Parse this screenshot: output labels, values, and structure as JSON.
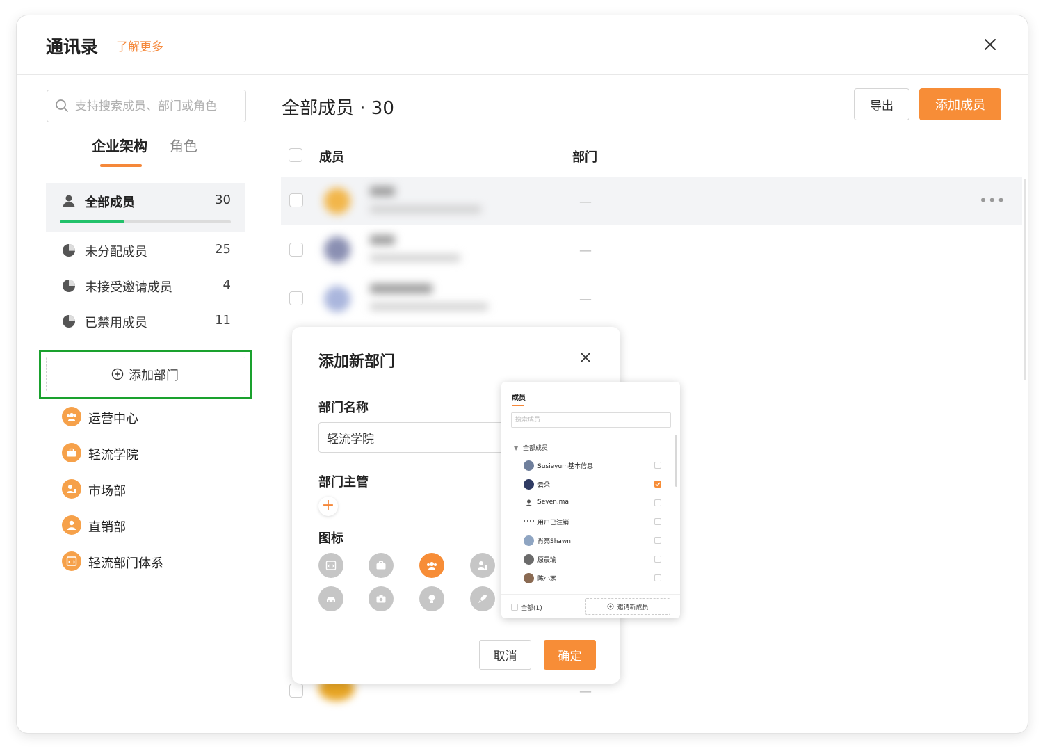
{
  "window": {
    "title": "通讯录",
    "learn_more": "了解更多"
  },
  "sidebar": {
    "search_placeholder": "支持搜索成员、部门或角色",
    "tabs": [
      {
        "label": "企业架构",
        "active": true
      },
      {
        "label": "角色",
        "active": false
      }
    ],
    "all_members": {
      "label": "全部成员",
      "count": "30",
      "progress": 0.38
    },
    "member_groups": [
      {
        "label": "未分配成员",
        "count": "25"
      },
      {
        "label": "未接受邀请成员",
        "count": "4"
      },
      {
        "label": "已禁用成员",
        "count": "11"
      }
    ],
    "add_department_label": "添加部门",
    "departments": [
      {
        "label": "运营中心",
        "icon": "group-icon"
      },
      {
        "label": "轻流学院",
        "icon": "briefcase-icon"
      },
      {
        "label": "市场部",
        "icon": "user-chart-icon"
      },
      {
        "label": "直销部",
        "icon": "user-icon"
      },
      {
        "label": "轻流部门体系",
        "icon": "code-window-icon"
      }
    ]
  },
  "main": {
    "title": "全部成员 · 30",
    "export_label": "导出",
    "add_member_label": "添加成员",
    "columns": {
      "member": "成员",
      "department": "部门"
    },
    "rows_dept_placeholder": "—"
  },
  "modal": {
    "title": "添加新部门",
    "name_label": "部门名称",
    "name_value": "轻流学院",
    "manager_label": "部门主管",
    "icon_label": "图标",
    "icon_options": [
      "code-window-icon",
      "briefcase-icon",
      "group-icon",
      "user-chart-icon",
      "car-icon",
      "camera-icon",
      "bulb-icon",
      "rocket-icon"
    ],
    "selected_icon": "group-icon",
    "cancel_label": "取消",
    "ok_label": "确定"
  },
  "picker": {
    "title": "成员",
    "search_placeholder": "搜索成员",
    "group_label": "全部成员",
    "members": [
      {
        "name": "Susieyum基本信息",
        "checked": false
      },
      {
        "name": "云朵",
        "checked": true
      },
      {
        "name": "Seven.ma",
        "checked": false
      },
      {
        "name": "用户已注销",
        "checked": false
      },
      {
        "name": "肖亮Shawn",
        "checked": false
      },
      {
        "name": "原晨瑜",
        "checked": false
      },
      {
        "name": "陈小寒",
        "checked": false
      }
    ],
    "select_all_label": "全部(1)",
    "invite_label": "邀请新成员"
  },
  "colors": {
    "accent": "#f78d37",
    "highlight_border": "#1aa12e",
    "progress": "#22c16a"
  }
}
